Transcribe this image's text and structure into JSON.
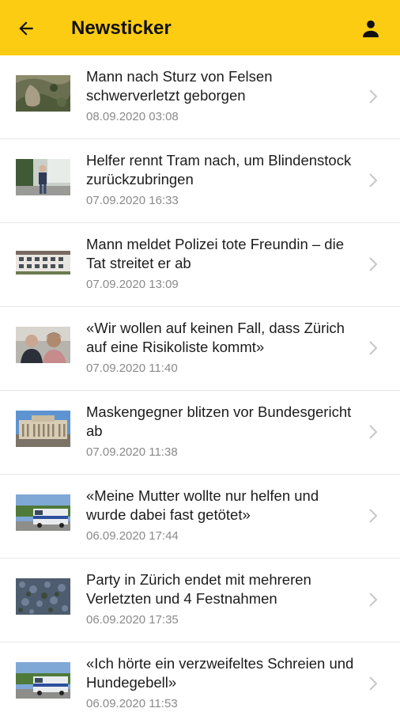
{
  "header": {
    "title": "Newsticker",
    "back_icon": "arrow-left-icon",
    "profile_icon": "person-icon",
    "background": "#fccc12"
  },
  "news": [
    {
      "title": "Mann nach Sturz von Felsen schwerverletzt geborgen",
      "date": "08.09.2020 03:08",
      "image": "aerial-terrain"
    },
    {
      "title": "Helfer rennt Tram nach, um Blindenstock zurückzubringen",
      "date": "07.09.2020 16:33",
      "image": "person-street"
    },
    {
      "title": "Mann meldet Polizei tote Freundin – die Tat streitet er ab",
      "date": "07.09.2020 13:09",
      "image": "apartment-building"
    },
    {
      "title": "«Wir wollen auf keinen Fall, dass Zürich auf eine Risikoliste kommt»",
      "date": "07.09.2020 11:40",
      "image": "two-people"
    },
    {
      "title": "Maskengegner blitzen vor Bundesgericht ab",
      "date": "07.09.2020 11:38",
      "image": "court-building"
    },
    {
      "title": "«Meine Mutter wollte nur helfen und wurde dabei fast getötet»",
      "date": "06.09.2020 17:44",
      "image": "police-van"
    },
    {
      "title": "Party in Zürich endet mit mehreren Verletzten und 4 Festnahmen",
      "date": "06.09.2020 17:35",
      "image": "aerial-city"
    },
    {
      "title": "«Ich hörte ein verzweifeltes Schreien und Hundegebell»",
      "date": "06.09.2020 11:53",
      "image": "police-van"
    }
  ]
}
